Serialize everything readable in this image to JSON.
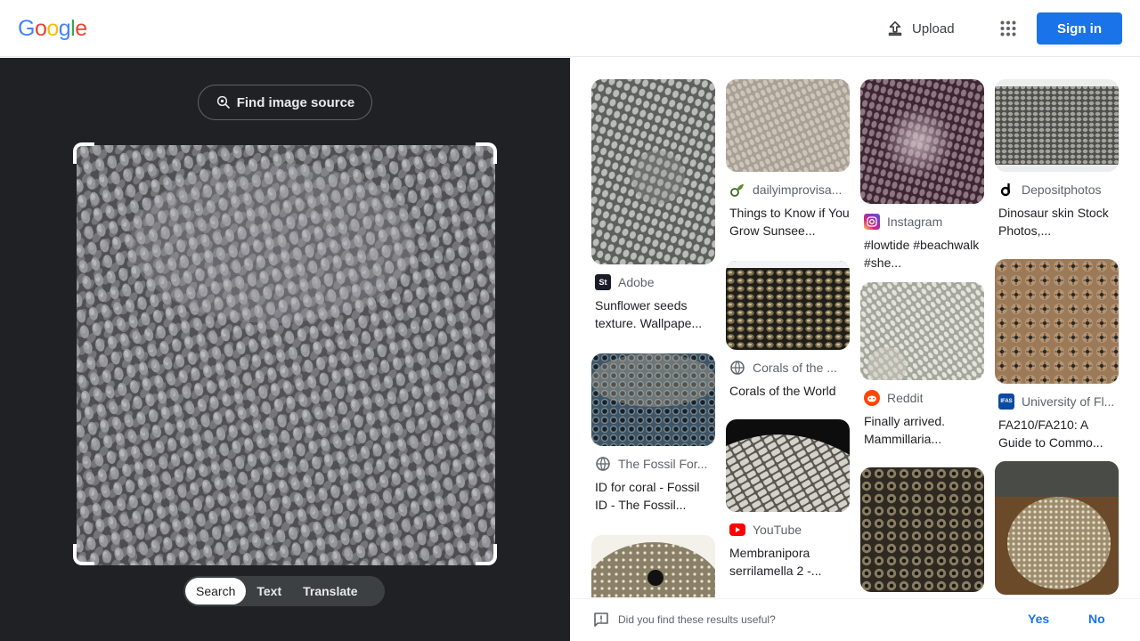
{
  "header": {
    "logo_letters": [
      "G",
      "o",
      "o",
      "g",
      "l",
      "e"
    ],
    "logo_colors": [
      "#4285f4",
      "#ea4335",
      "#fbbc05",
      "#4285f4",
      "#34a853",
      "#ea4335"
    ],
    "upload_label": "Upload",
    "apps_icon": "apps-grid-icon",
    "signin_label": "Sign in"
  },
  "lens": {
    "find_source_label": "Find image source",
    "modes": [
      {
        "label": "Search",
        "active": true
      },
      {
        "label": "Text",
        "active": false
      },
      {
        "label": "Translate",
        "active": false
      }
    ]
  },
  "results": [
    {
      "source": "Adobe",
      "favicon": "adobe-stock-icon",
      "title": "Sunflower seeds texture. Wallpape..."
    },
    {
      "source": "The Fossil For...",
      "favicon": "globe-icon",
      "title": "ID for coral - Fossil ID - The Fossil..."
    },
    {
      "source": "dailyimprovisa...",
      "favicon": "dailyimprovisation-icon",
      "title": "Things to Know if You Grow Sunsee..."
    },
    {
      "source": "Corals of the ...",
      "favicon": "globe-icon",
      "title": "Corals of the World"
    },
    {
      "source": "YouTube",
      "favicon": "youtube-icon",
      "title": "Membranipora serrilamella 2 -..."
    },
    {
      "source": "Instagram",
      "favicon": "instagram-icon",
      "title": "#lowtide #beachwalk #she..."
    },
    {
      "source": "Reddit",
      "favicon": "reddit-icon",
      "title": "Finally arrived. Mammillaria..."
    },
    {
      "source": "Depositphotos",
      "favicon": "depositphotos-icon",
      "title": "Dinosaur skin Stock Photos,..."
    },
    {
      "source": "University of Fl...",
      "favicon": "ifas-icon",
      "title": "FA210/FA210: A Guide to Commo..."
    }
  ],
  "feedback": {
    "question": "Did you find these results useful?",
    "yes_label": "Yes",
    "no_label": "No"
  }
}
